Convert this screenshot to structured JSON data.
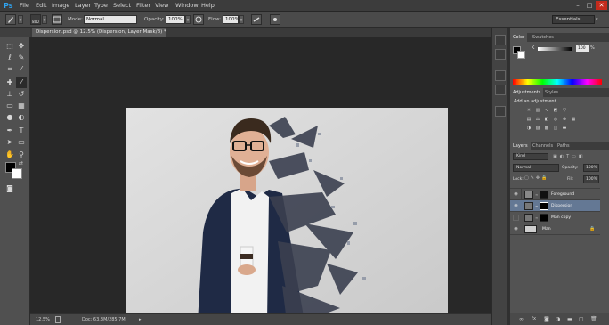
{
  "app": {
    "logo": "Ps"
  },
  "menu": [
    "File",
    "Edit",
    "Image",
    "Layer",
    "Type",
    "Select",
    "Filter",
    "View",
    "Window",
    "Help"
  ],
  "window_controls": [
    "–",
    "□",
    "✕"
  ],
  "options": {
    "brush_size": "800",
    "mode_label": "Mode:",
    "mode_value": "Normal",
    "opacity_label": "Opacity:",
    "opacity_value": "100%",
    "flow_label": "Flow:",
    "flow_value": "100%",
    "workspace": "Essentials"
  },
  "document": {
    "tab_title": "Dispersion.psd @ 12.5% (Dispersion, Layer Mask/8) *",
    "zoom": "12.5%",
    "doc_info": "Doc: 63.3M/285.7M"
  },
  "color_panel": {
    "tabs": [
      "Color",
      "Swatches"
    ],
    "slider_label": "K",
    "slider_value": "100",
    "slider_unit": "%"
  },
  "adjustments_panel": {
    "tabs": [
      "Adjustments",
      "Styles"
    ],
    "heading": "Add an adjustment"
  },
  "layers_panel": {
    "tabs": [
      "Layers",
      "Channels",
      "Paths"
    ],
    "filter_kind": "Kind",
    "blend_mode": "Normal",
    "opacity_label": "Opacity:",
    "opacity_value": "100%",
    "lock_label": "Lock:",
    "fill_label": "Fill:",
    "fill_value": "100%",
    "layers": [
      {
        "name": "Foreground",
        "visible": true,
        "selected": false
      },
      {
        "name": "Dispersion",
        "visible": true,
        "selected": true
      },
      {
        "name": "Man copy",
        "visible": false,
        "selected": false
      },
      {
        "name": "Man",
        "visible": true,
        "selected": false
      }
    ]
  },
  "icons": [
    "brush-icon",
    "move-icon",
    "marquee-icon",
    "lasso-icon",
    "crop-icon",
    "eyedropper-icon",
    "heal-icon",
    "brush-tool-icon",
    "stamp-icon",
    "history-brush-icon",
    "eraser-icon",
    "gradient-icon",
    "blur-icon",
    "dodge-icon",
    "pen-icon",
    "type-icon",
    "path-select-icon",
    "shape-icon",
    "hand-icon",
    "zoom-icon",
    "eye-icon",
    "lock-icon",
    "link-icon",
    "fx-icon",
    "mask-icon",
    "folder-icon",
    "new-layer-icon",
    "trash-icon"
  ],
  "colors": {
    "foreground": "#000000",
    "background": "#ffffff",
    "selected_layer": "#647894",
    "accent": "#2fa3f0"
  }
}
